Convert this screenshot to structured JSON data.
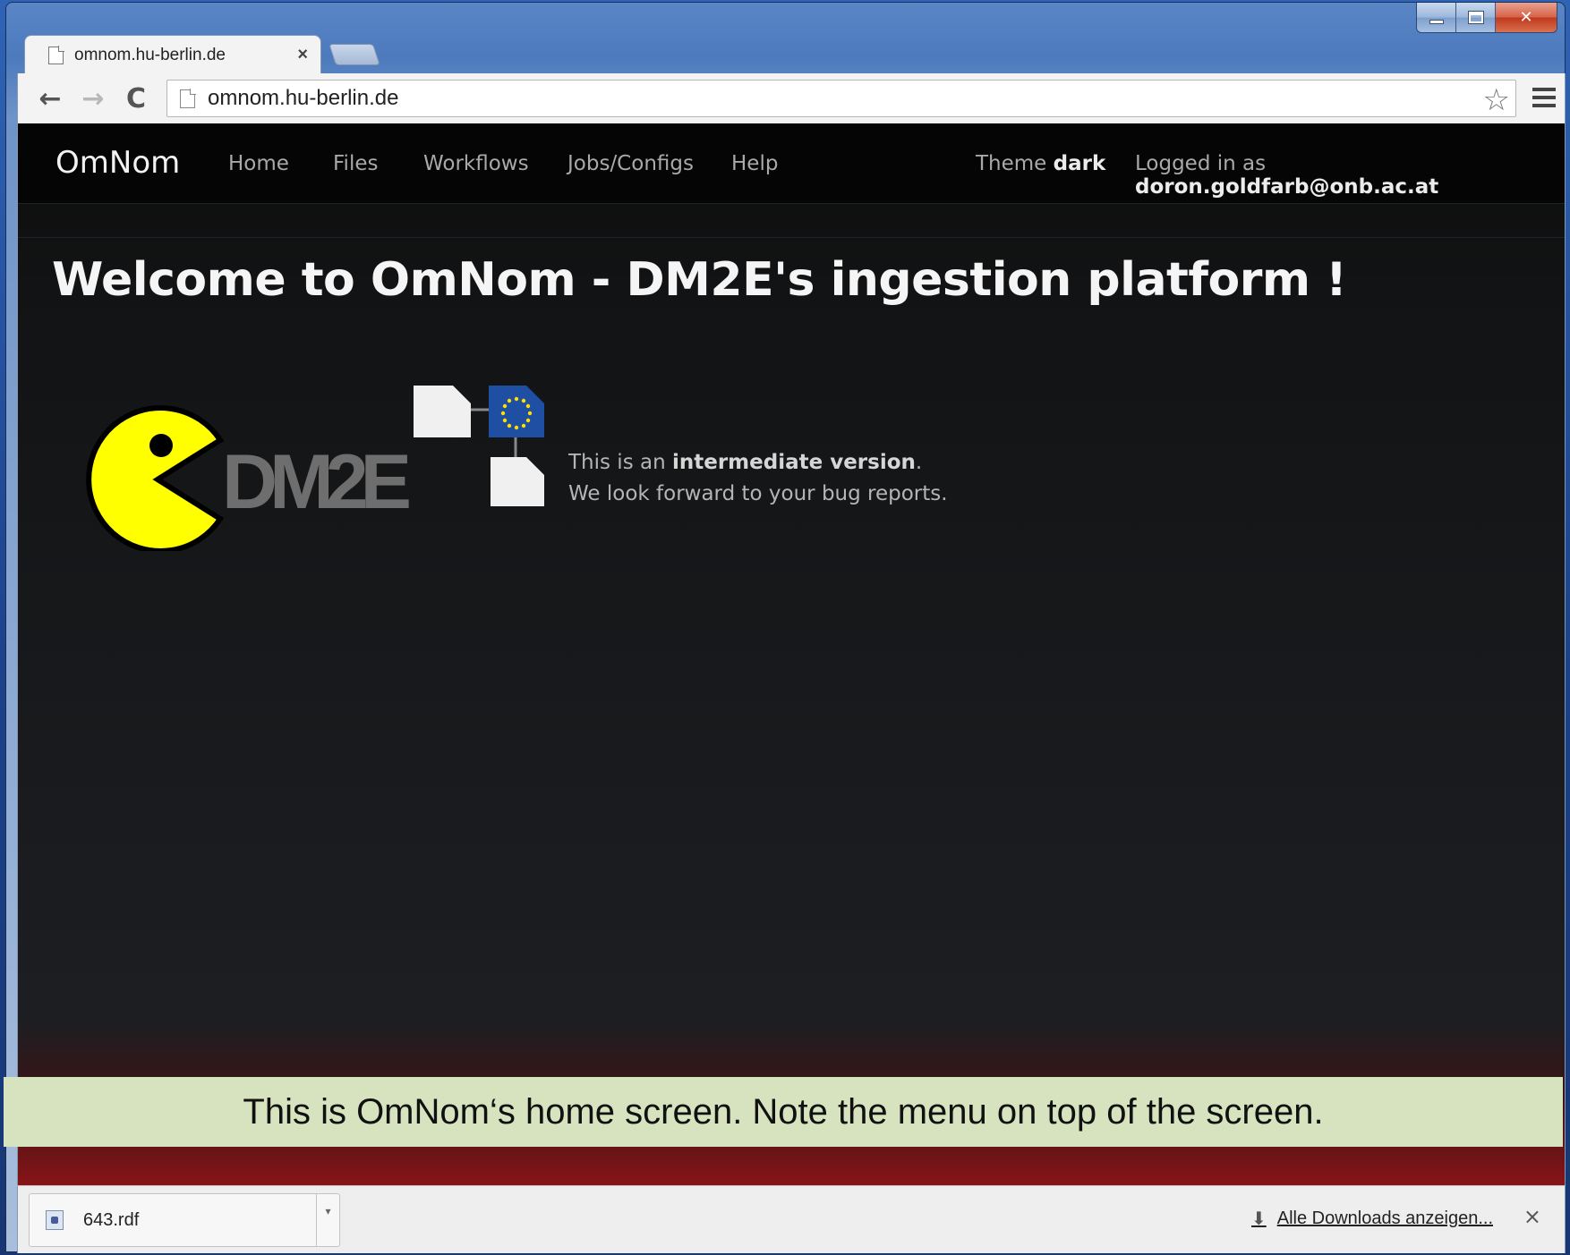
{
  "browser": {
    "tab_title": "omnom.hu-berlin.de",
    "tab_close": "×",
    "url": "omnom.hu-berlin.de",
    "back_icon": "←",
    "forward_icon": "→",
    "reload_icon": "C",
    "bookmark_icon": "☆"
  },
  "navbar": {
    "brand": "OmNom",
    "items": [
      "Home",
      "Files",
      "Workflows",
      "Jobs/Configs",
      "Help"
    ],
    "theme_label": "Theme",
    "theme_value": "dark",
    "login_label": "Logged in as",
    "login_user": "doron.goldfarb@onb.ac.at"
  },
  "main": {
    "headline": "Welcome to OmNom - DM2E's ingestion platform !",
    "logo_text": "DM2E",
    "intro_prefix": "This is an",
    "intro_bold": "intermediate version",
    "intro_suffix": ".",
    "intro_line2": "We look forward to your bug reports."
  },
  "annotation": {
    "text": "This is OmNom‘s home screen. Note the menu on top of the screen."
  },
  "downloads": {
    "file_name": "643.rdf",
    "show_all": "Alle Downloads anzeigen...",
    "close": "×"
  },
  "colors": {
    "navbar_bg": "#050505",
    "pacman_yellow": "#ffff00",
    "eu_blue": "#1f4fa3",
    "annotation_bg": "#d7e3bf"
  }
}
